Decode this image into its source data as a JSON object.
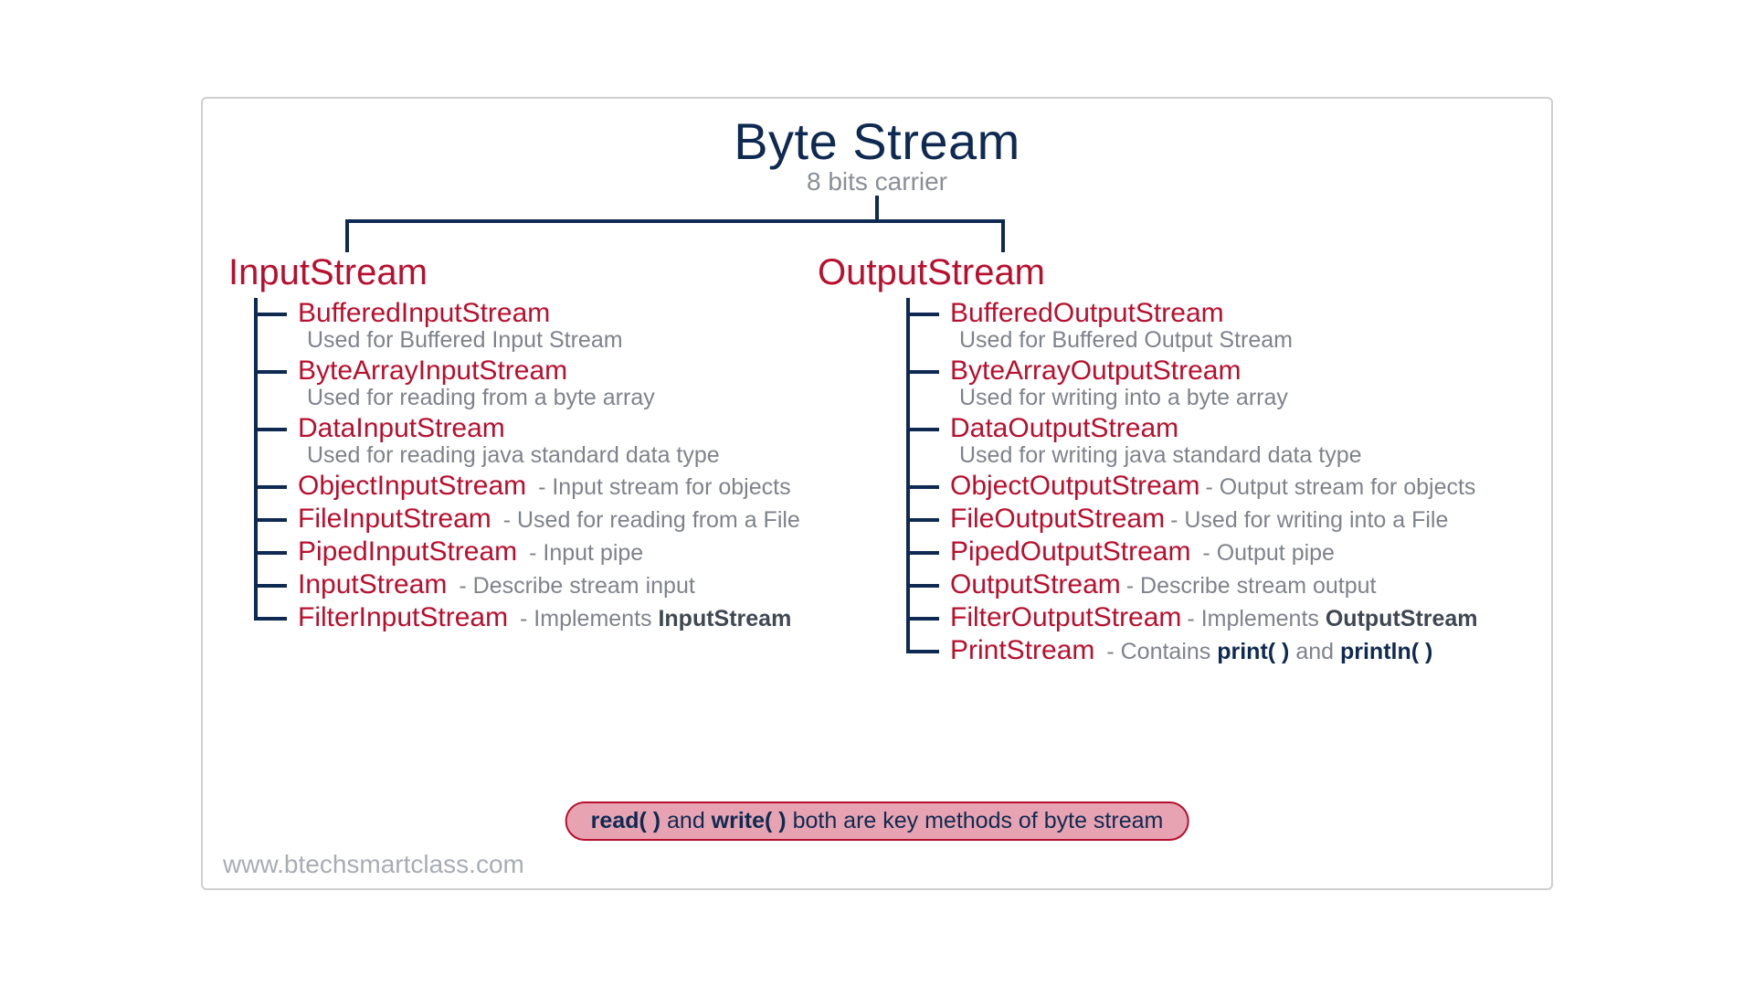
{
  "title": "Byte Stream",
  "subtitle": "8 bits carrier",
  "branches": {
    "input": {
      "label": "InputStream",
      "items": [
        {
          "name": "BufferedInputStream",
          "desc": "Used for Buffered Input Stream",
          "layout": "below"
        },
        {
          "name": "ByteArrayInputStream",
          "desc": "Used for reading from a byte array",
          "layout": "below"
        },
        {
          "name": "DataInputStream",
          "desc": "Used for reading java standard data type",
          "layout": "below"
        },
        {
          "name": "ObjectInputStream",
          "sep": "  - ",
          "desc": "Input stream for objects",
          "layout": "inline"
        },
        {
          "name": "FileInputStream",
          "sep": " - ",
          "desc": "Used for reading from a File",
          "layout": "inline"
        },
        {
          "name": "PipedInputStream",
          "sep": " - ",
          "desc": "Input pipe",
          "layout": "inline"
        },
        {
          "name": "InputStream",
          "sep": "  - ",
          "desc": "Describe stream input",
          "layout": "inline"
        },
        {
          "name": "FilterInputStream",
          "sep": "  - ",
          "desc_pre": "Implements ",
          "desc_bold": "InputStream",
          "layout": "inline-bold"
        }
      ]
    },
    "output": {
      "label": "OutputStream",
      "items": [
        {
          "name": "BufferedOutputStream",
          "desc": "Used for Buffered Output Stream",
          "layout": "below"
        },
        {
          "name": "ByteArrayOutputStream",
          "desc": "Used for writing into a byte array",
          "layout": "below"
        },
        {
          "name": "DataOutputStream",
          "desc": "Used for writing java standard data type",
          "layout": "below"
        },
        {
          "name": "ObjectOutputStream",
          "sep": "- ",
          "desc": "Output stream for objects",
          "layout": "inline"
        },
        {
          "name": "FileOutputStream",
          "sep": "- ",
          "desc": "Used for writing into a File",
          "layout": "inline"
        },
        {
          "name": "PipedOutputStream",
          "sep": " - ",
          "desc": "Output pipe",
          "layout": "inline"
        },
        {
          "name": "OutputStream",
          "sep": "- ",
          "desc": "Describe stream output",
          "layout": "inline"
        },
        {
          "name": "FilterOutputStream",
          "sep": "- ",
          "desc_pre": "Implements ",
          "desc_bold": "OutputStream",
          "layout": "inline-bold"
        },
        {
          "name": "PrintStream",
          "sep": "   - ",
          "desc_parts": [
            "Contains ",
            {
              "navy": "print( )"
            },
            " and ",
            {
              "navy": "println( )"
            }
          ],
          "layout": "inline-parts"
        }
      ]
    }
  },
  "footnote": {
    "b1": "read( )",
    "mid": " and ",
    "b2": "write( )",
    "rest": " both are key methods of byte stream"
  },
  "watermark": "www.btechsmartclass.com"
}
